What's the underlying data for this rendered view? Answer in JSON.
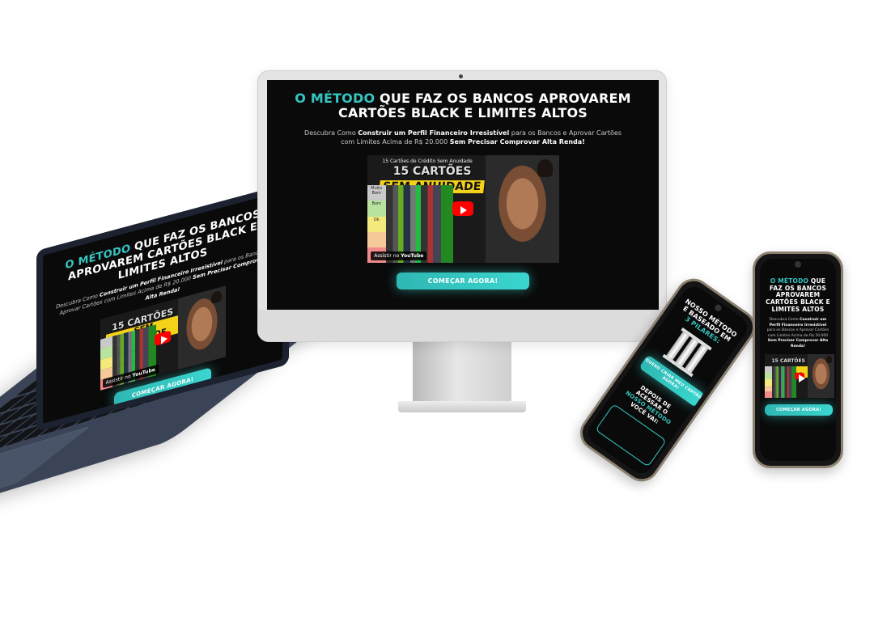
{
  "landing": {
    "headline_accent": "O MÉTODO",
    "headline_rest": " QUE FAZ OS BANCOS APROVAREM CARTÕES BLACK E LIMITES ALTOS",
    "sub_1": "Descubra Como ",
    "sub_bold_1": "Construir um Perfil Financeiro Irresistível",
    "sub_2": " para os Bancos e Aprovar Cartões com Limites Acima de R$ 20.000 ",
    "sub_bold_2": "Sem Precisar Comprovar Alta Renda!",
    "cta_label": "COMEÇAR AGORA!"
  },
  "video": {
    "title": "15 Cartões de Crédito Sem Anuidade",
    "banner_top": "15 CARTÕES",
    "banner_yellow": "SEM ANUIDADE",
    "tiers": [
      "Muito Bom",
      "Bom",
      "Ok",
      "",
      ""
    ],
    "watch_on": "Assistir no",
    "watch_brand": "YouTube"
  },
  "phone_b": {
    "heading_1": "NOSSO MÉTODO É BASEADO EM ",
    "heading_accent": "3 PILARES:",
    "cta_label": "QUERO CRIAR MEU CARTÃO AGORA!",
    "footer_1": "DEPOIS DE ACESSAR O ",
    "footer_accent": "NOSSO MÉTODO",
    "footer_2": " VOCÊ VAI:"
  },
  "colors": {
    "accent": "#35c6c2",
    "background": "#0a0a0a",
    "cta": "#3ad6cf"
  }
}
